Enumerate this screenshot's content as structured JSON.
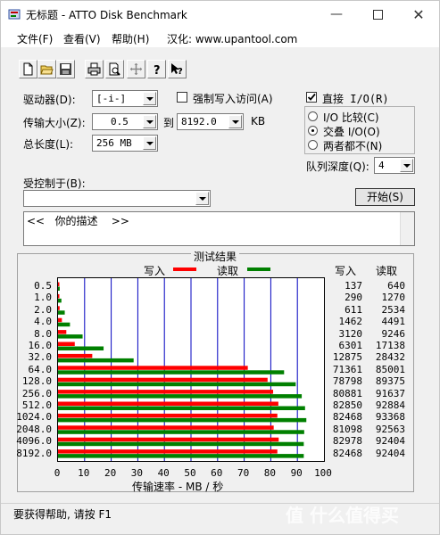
{
  "window": {
    "title": "无标题 - ATTO Disk Benchmark"
  },
  "menu": [
    "文件(F)",
    "查看(V)",
    "帮助(H)",
    "汉化: www.upantool.com"
  ],
  "toolbar_icons": [
    "new-file-icon",
    "open-folder-icon",
    "save-icon",
    "print-icon",
    "print-preview-icon",
    "move-icon",
    "help-icon",
    "context-help-icon"
  ],
  "settings": {
    "drive_label": "驱动器(D):",
    "drive_value": "[-i-]",
    "force_write_label": "强制写入访问(A)",
    "direct_io_label": "直接 I/O(R)",
    "transfer_size_label": "传输大小(Z):",
    "transfer_from": "0.5",
    "to_label": "到",
    "transfer_to": "8192.0",
    "kb_label": "KB",
    "total_length_label": "总长度(L):",
    "total_length_value": "256 MB",
    "io_compare_label": "I/O 比较(C)",
    "io_overlap_label": "交叠 I/O(O)",
    "neither_label": "两者都不(N)",
    "queue_depth_label": "队列深度(Q):",
    "queue_depth_value": "4",
    "controlled_by_label": "受控制于(B):",
    "start_button": "开始(S)",
    "description": "<<   你的描述    >>"
  },
  "results": {
    "group_title": "测试结果",
    "write_legend": "写入",
    "read_legend": "读取",
    "write_header": "写入",
    "read_header": "读取",
    "xlabel": "传输速率 - MB / 秒"
  },
  "status": "要获得帮助, 请按 F1",
  "watermark": "值 什么值得买",
  "colors": {
    "write": "#ff0000",
    "read": "#008000",
    "grid": "#0000c0"
  },
  "chart_data": {
    "type": "bar",
    "orientation": "horizontal",
    "categories": [
      "0.5",
      "1.0",
      "2.0",
      "4.0",
      "8.0",
      "16.0",
      "32.0",
      "64.0",
      "128.0",
      "256.0",
      "512.0",
      "1024.0",
      "2048.0",
      "4096.0",
      "8192.0"
    ],
    "series": [
      {
        "name": "写入",
        "values": [
          137,
          290,
          611,
          1462,
          3120,
          6301,
          12875,
          71361,
          78798,
          80881,
          82850,
          82468,
          81098,
          82978,
          82468
        ]
      },
      {
        "name": "读取",
        "values": [
          640,
          1270,
          2534,
          4491,
          9246,
          17138,
          28432,
          85001,
          89375,
          91637,
          92884,
          93368,
          92563,
          92404,
          92404
        ]
      }
    ],
    "xlim": [
      0,
      100
    ],
    "xticks": [
      "0",
      "10",
      "20",
      "30",
      "40",
      "50",
      "60",
      "70",
      "80",
      "90",
      "100"
    ],
    "xlabel": "传输速率 - MB / 秒",
    "unit_note": "bar lengths are KB/s values divided by 1000 (MB/s)"
  }
}
